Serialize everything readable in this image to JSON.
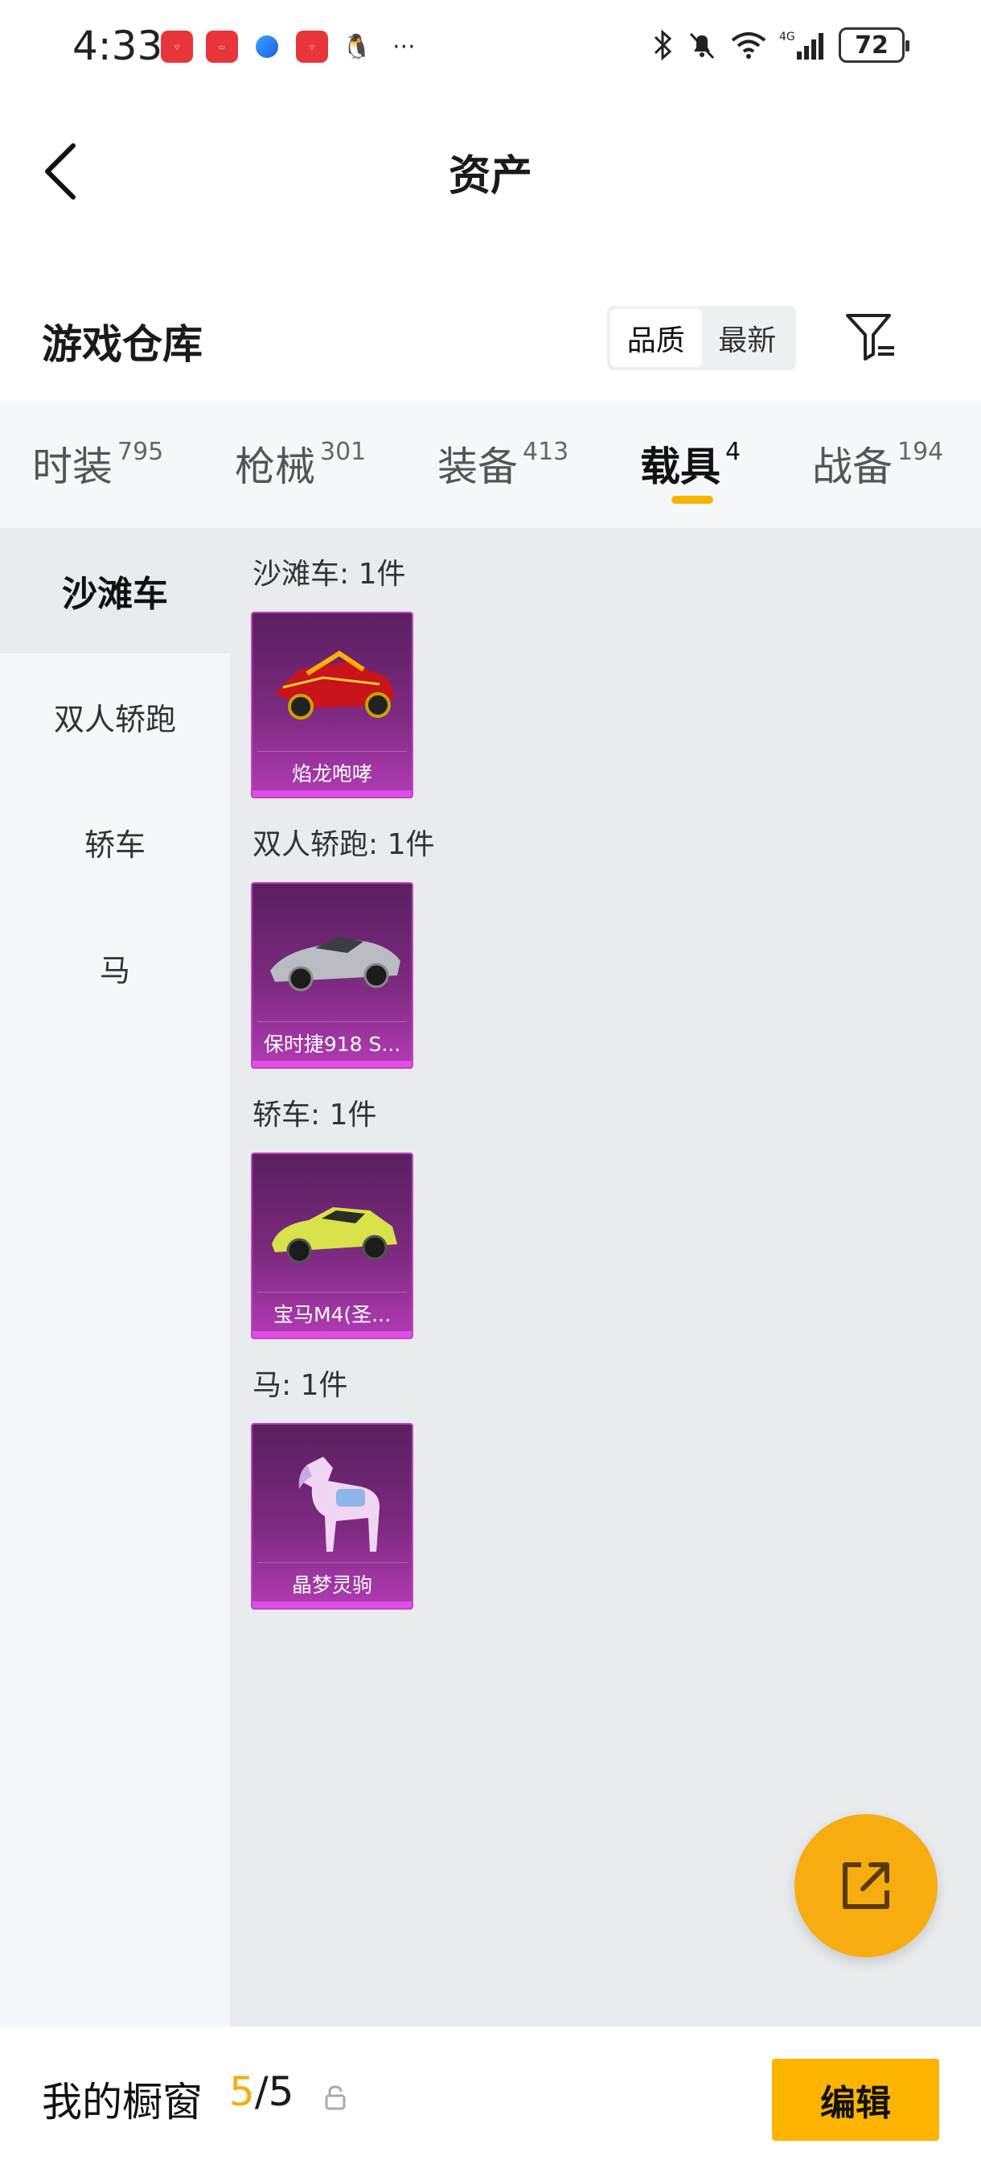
{
  "status_bar": {
    "time": "4:33",
    "app_icons": [
      "huawei-icon",
      "tablet-icon",
      "browser-icon",
      "huawei-icon",
      "qq-icon"
    ],
    "more": "···",
    "battery": "72"
  },
  "header": {
    "title": "资产"
  },
  "warehouse": {
    "title": "游戏仓库",
    "sort_options": [
      "品质",
      "最新"
    ],
    "sort_active": "品质"
  },
  "tabs": [
    {
      "label": "时装",
      "count": "795"
    },
    {
      "label": "枪械",
      "count": "301"
    },
    {
      "label": "装备",
      "count": "413"
    },
    {
      "label": "载具",
      "count": "4",
      "active": true
    },
    {
      "label": "战备",
      "count": "194"
    }
  ],
  "side_categories": [
    "沙滩车",
    "双人轿跑",
    "轿车",
    "马"
  ],
  "groups": [
    {
      "title": "沙滩车: 1件",
      "item": "焰龙咆哮"
    },
    {
      "title": "双人轿跑: 1件",
      "item": "保时捷918 S..."
    },
    {
      "title": "轿车: 1件",
      "item": "宝马M4(圣..."
    },
    {
      "title": "马: 1件",
      "item": "晶梦灵驹"
    }
  ],
  "footer": {
    "title": "我的橱窗",
    "count_current": "5",
    "count_total": "/5",
    "edit_label": "编辑"
  },
  "colors": {
    "accent": "#f7ac10",
    "card_purple": "#7d2a80"
  }
}
